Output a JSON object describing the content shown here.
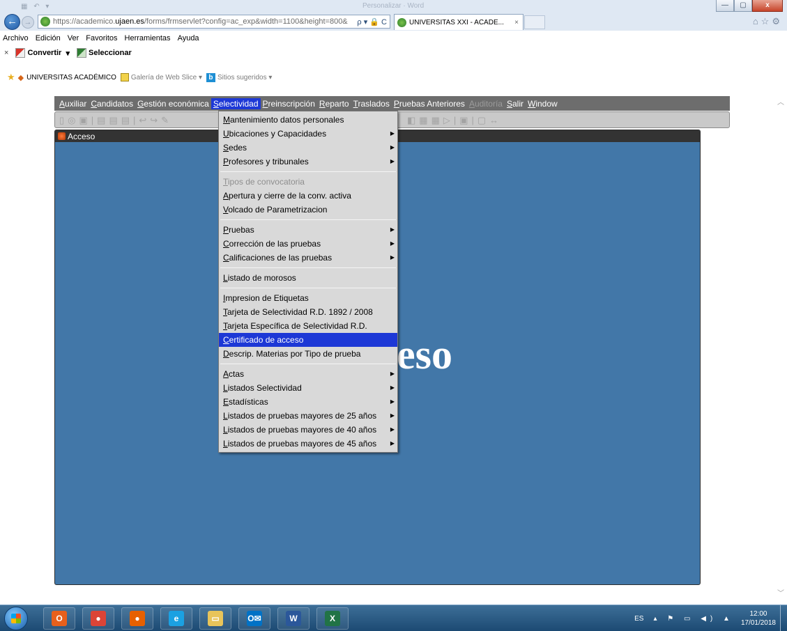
{
  "browser": {
    "window_title": "Personalizar · Word",
    "url_host": "https://academico.",
    "url_domain": "ujaen.es",
    "url_path": "/forms/frmservlet?config=ac_exp&width=1100&height=800&",
    "url_icons": "ρ ▾ 🔒 C",
    "tab_title": "UNIVERSITAS XXI - ACADE...",
    "tab_close": "×"
  },
  "ie_menu": [
    "Archivo",
    "Edición",
    "Ver",
    "Favoritos",
    "Herramientas",
    "Ayuda"
  ],
  "command_bar": {
    "close": "×",
    "convert": "Convertir",
    "convert_arrow": "▾",
    "select": "Seleccionar"
  },
  "favorites_bar": {
    "site": "UNIVERSITAS ACADÉMICO",
    "gallery": "Galería de Web Slice",
    "gallery_arrow": "▾",
    "suggested": "Sitios sugeridos",
    "suggested_arrow": "▾"
  },
  "app_menu": [
    {
      "key": "A",
      "rest": "uxiliar",
      "state": "normal"
    },
    {
      "key": "C",
      "rest": "andidatos",
      "state": "normal"
    },
    {
      "key": "G",
      "rest": "estión económica",
      "state": "normal"
    },
    {
      "key": "S",
      "rest": "electividad",
      "state": "active"
    },
    {
      "key": "P",
      "rest": "reinscripción",
      "state": "normal"
    },
    {
      "key": "R",
      "rest": "eparto",
      "state": "normal"
    },
    {
      "key": "T",
      "rest": "raslados",
      "state": "normal"
    },
    {
      "key": "P",
      "rest": "ruebas Anteriores",
      "state": "normal"
    },
    {
      "key": "A",
      "rest": "uditoría",
      "state": "disabled"
    },
    {
      "key": "S",
      "rest": "alir",
      "state": "normal"
    },
    {
      "key": "W",
      "rest": "indow",
      "state": "normal"
    }
  ],
  "form_window": {
    "title": "Acceso",
    "big_text": "eso"
  },
  "dropdown": {
    "groups": [
      [
        {
          "key": "M",
          "rest": "antenimiento datos personales",
          "submenu": false,
          "state": "normal"
        },
        {
          "key": "U",
          "rest": "bicaciones y Capacidades",
          "submenu": true,
          "state": "normal"
        },
        {
          "key": "S",
          "rest": "edes",
          "submenu": true,
          "state": "normal"
        },
        {
          "key": "P",
          "rest": "rofesores y tribunales",
          "submenu": true,
          "state": "normal"
        }
      ],
      [
        {
          "key": "T",
          "rest": "ipos de convocatoria",
          "submenu": false,
          "state": "disabled"
        },
        {
          "key": "A",
          "rest": "pertura y cierre de la conv. activa",
          "submenu": false,
          "state": "normal"
        },
        {
          "key": "V",
          "rest": "olcado de Parametrizacion",
          "submenu": false,
          "state": "normal"
        }
      ],
      [
        {
          "key": "P",
          "rest": "ruebas",
          "submenu": true,
          "state": "normal"
        },
        {
          "key": "C",
          "rest": "orrección de las pruebas",
          "submenu": true,
          "state": "normal"
        },
        {
          "key": "C",
          "rest": "alificaciones de las pruebas",
          "submenu": true,
          "state": "normal"
        }
      ],
      [
        {
          "key": "L",
          "rest": "istado de morosos",
          "submenu": false,
          "state": "normal"
        }
      ],
      [
        {
          "key": "I",
          "rest": "mpresion de Etiquetas",
          "submenu": false,
          "state": "normal"
        },
        {
          "key": "T",
          "rest": "arjeta de Selectividad R.D. 1892 / 2008",
          "submenu": false,
          "state": "normal"
        },
        {
          "key": "T",
          "rest": "arjeta Específica de Selectividad R.D.",
          "submenu": false,
          "state": "normal"
        },
        {
          "key": "C",
          "rest": "ertificado de acceso",
          "submenu": false,
          "state": "highlight"
        },
        {
          "key": "D",
          "rest": "escrip. Materias por Tipo de prueba",
          "submenu": false,
          "state": "normal"
        }
      ],
      [
        {
          "key": "A",
          "rest": "ctas",
          "submenu": true,
          "state": "normal"
        },
        {
          "key": "L",
          "rest": "istados Selectividad",
          "submenu": true,
          "state": "normal"
        },
        {
          "key": "E",
          "rest": "stadísticas",
          "submenu": true,
          "state": "normal"
        },
        {
          "key": "L",
          "rest": "istados de pruebas mayores de 25 años",
          "submenu": true,
          "state": "normal"
        },
        {
          "key": "L",
          "rest": "istados de pruebas mayores de 40 años",
          "submenu": true,
          "state": "normal"
        },
        {
          "key": "L",
          "rest": "istados de pruebas mayores de 45 años",
          "submenu": true,
          "state": "normal"
        }
      ]
    ],
    "submenu_arrow": "▶"
  },
  "taskbar": {
    "apps": [
      {
        "name": "outlook-icon",
        "glyph": "O",
        "color": "#e8601c"
      },
      {
        "name": "chrome-icon",
        "glyph": "●",
        "color": "#db4437"
      },
      {
        "name": "firefox-icon",
        "glyph": "●",
        "color": "#e66000"
      },
      {
        "name": "internet-explorer-icon",
        "glyph": "e",
        "color": "#1ba1e2"
      },
      {
        "name": "file-explorer-icon",
        "glyph": "▭",
        "color": "#e8c45a"
      },
      {
        "name": "outlook-mail-icon",
        "glyph": "O✉",
        "color": "#0072c6"
      },
      {
        "name": "word-icon",
        "glyph": "W",
        "color": "#2b579a"
      },
      {
        "name": "excel-icon",
        "glyph": "X",
        "color": "#217346"
      }
    ],
    "lang": "ES",
    "tray_icons": "▴ ⚑ ▭ ◀) ▲",
    "time": "12:00",
    "date": "17/01/2018"
  },
  "colors": {
    "form_background": "#4277a8",
    "menu_highlight": "#1d38d6",
    "app_menubar": "#6d6d6d"
  }
}
